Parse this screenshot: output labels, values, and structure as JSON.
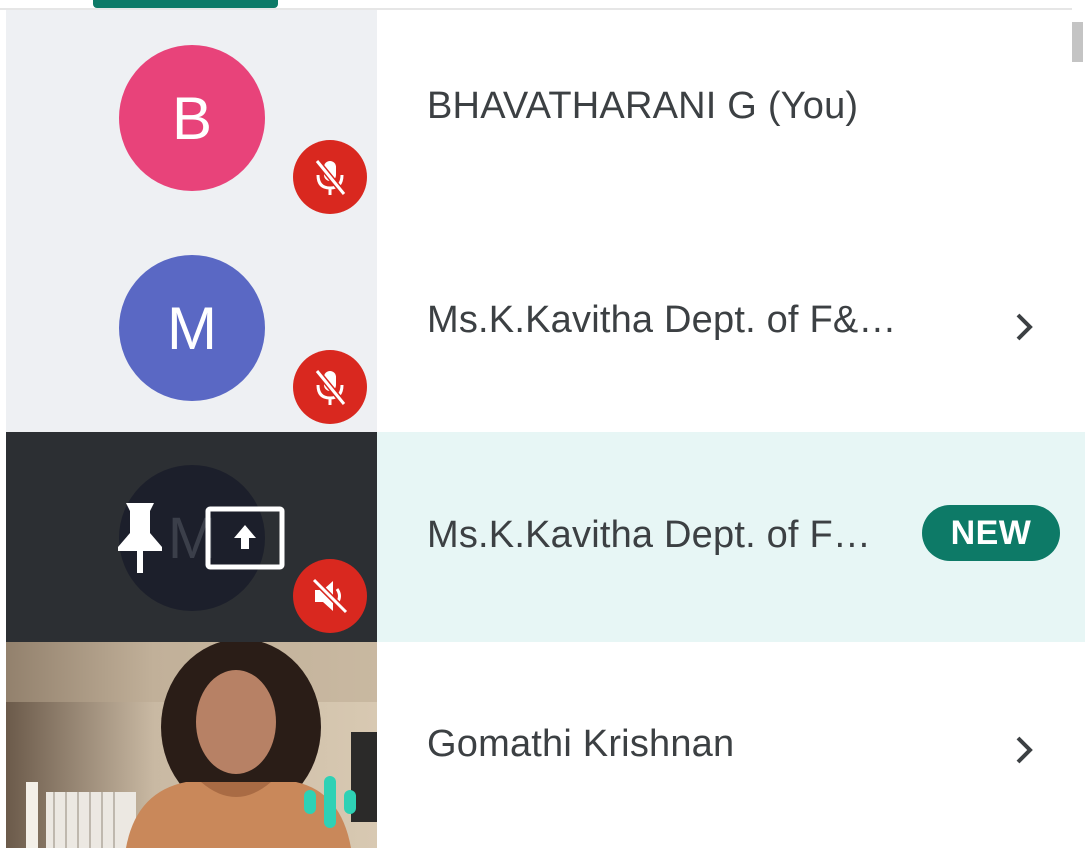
{
  "participants": [
    {
      "initial": "B",
      "name": "BHAVATHARANI G (You)",
      "avatar_color": "#e8437a",
      "status_icon": "mic-off-icon",
      "has_chevron": false
    },
    {
      "initial": "M",
      "name": "Ms.K.Kavitha Dept. of F&…",
      "avatar_color": "#5a68c4",
      "status_icon": "mic-off-icon",
      "has_chevron": true
    },
    {
      "initial": "M",
      "name": "Ms.K.Kavitha Dept. of F…",
      "status_icon": "volume-off-icon",
      "tile_icons": [
        "pin-icon",
        "present-screen-icon"
      ],
      "badge": "NEW",
      "has_chevron": false
    },
    {
      "name": "Gomathi Krishnan",
      "status_icon": "voice-activity-icon",
      "has_chevron": true
    }
  ],
  "colors": {
    "accent": "#0d7a67",
    "mute_red": "#d9281f",
    "highlight_row": "#e7f6f5",
    "tile_bg": "#eef0f3"
  }
}
